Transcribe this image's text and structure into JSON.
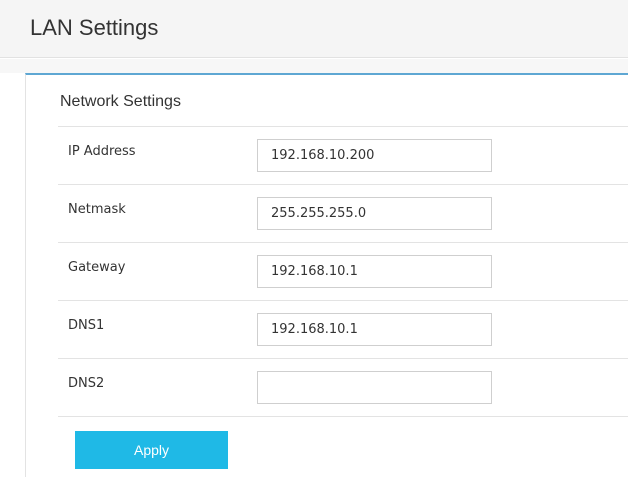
{
  "page": {
    "title": "LAN Settings"
  },
  "network": {
    "section_title": "Network Settings",
    "fields": [
      {
        "label": "IP Address",
        "value": "192.168.10.200"
      },
      {
        "label": "Netmask",
        "value": "255.255.255.0"
      },
      {
        "label": "Gateway",
        "value": "192.168.10.1"
      },
      {
        "label": "DNS1",
        "value": "192.168.10.1"
      },
      {
        "label": "DNS2",
        "value": ""
      }
    ],
    "apply_label": "Apply"
  },
  "colors": {
    "accent": "#1fb9e6",
    "panel_top_border": "#5ea7d3"
  }
}
